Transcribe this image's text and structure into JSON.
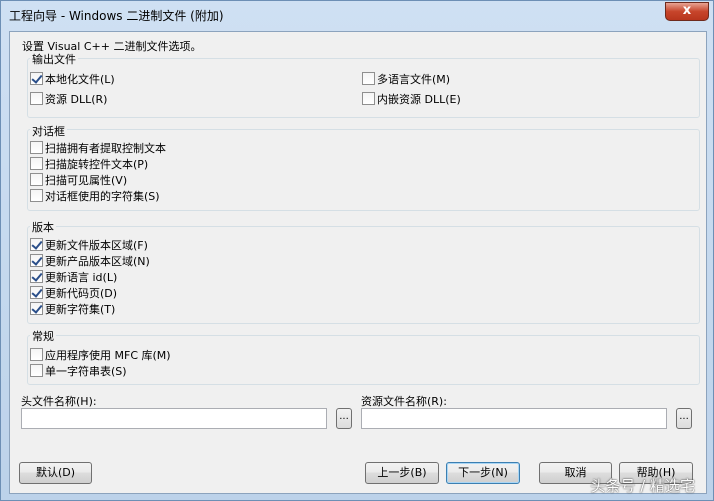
{
  "window": {
    "title": "工程向导 - Windows 二进制文件 (附加)",
    "close_glyph": "x"
  },
  "subtitle": "设置 Visual C++ 二进制文件选项。",
  "groups": {
    "output": {
      "label": "输出文件",
      "items": [
        {
          "label": "本地化文件(L)",
          "checked": true
        },
        {
          "label": "多语言文件(M)",
          "checked": false
        },
        {
          "label": "资源 DLL(R)",
          "checked": false
        },
        {
          "label": "内嵌资源 DLL(E)",
          "checked": false
        }
      ]
    },
    "dialog": {
      "label": "对话框",
      "items": [
        {
          "label": "扫描拥有者提取控制文本",
          "checked": false
        },
        {
          "label": "扫描旋转控件文本(P)",
          "checked": false
        },
        {
          "label": "扫描可见属性(V)",
          "checked": false
        },
        {
          "label": "对话框使用的字符集(S)",
          "checked": false
        }
      ]
    },
    "version": {
      "label": "版本",
      "items": [
        {
          "label": "更新文件版本区域(F)",
          "checked": true
        },
        {
          "label": "更新产品版本区域(N)",
          "checked": true
        },
        {
          "label": "更新语言 id(L)",
          "checked": true
        },
        {
          "label": "更新代码页(D)",
          "checked": true
        },
        {
          "label": "更新字符集(T)",
          "checked": true
        }
      ]
    },
    "general": {
      "label": "常规",
      "items": [
        {
          "label": "应用程序使用 MFC 库(M)",
          "checked": false
        },
        {
          "label": "单一字符串表(S)",
          "checked": false
        }
      ]
    }
  },
  "fields": {
    "header": {
      "label": "头文件名称(H):",
      "value": "",
      "browse": "..."
    },
    "resource": {
      "label": "资源文件名称(R):",
      "value": "",
      "browse": "..."
    }
  },
  "buttons": {
    "default": "默认(D)",
    "back": "上一步(B)",
    "next": "下一步(N)",
    "cancel": "取消",
    "help": "帮助(H)"
  },
  "watermark": "头条号 / 精选宅"
}
